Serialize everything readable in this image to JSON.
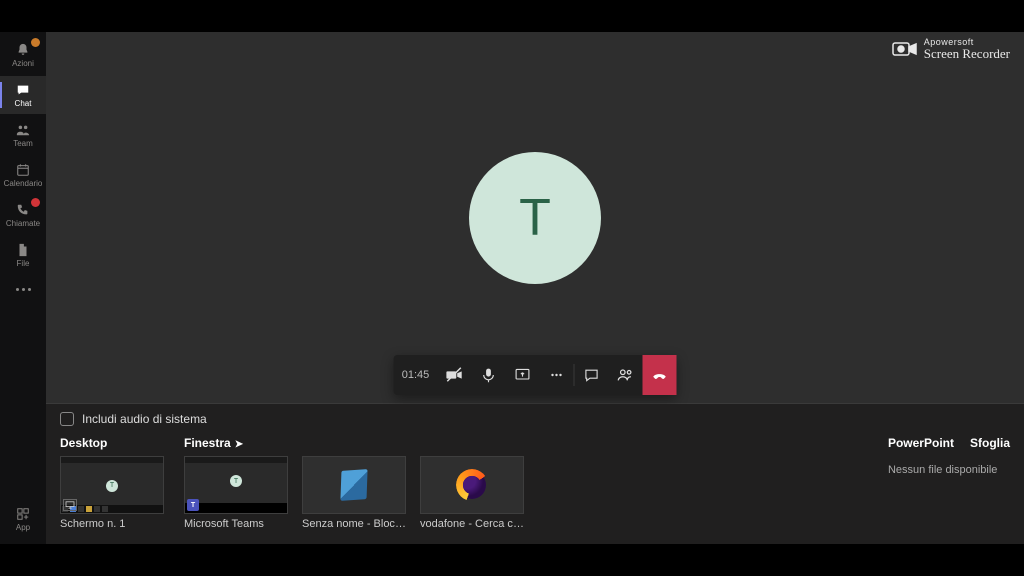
{
  "sidebar": {
    "items": [
      {
        "label": "Azioni",
        "name": "nav-azioni",
        "icon": "bell",
        "badge": "orange"
      },
      {
        "label": "Chat",
        "name": "nav-chat",
        "icon": "chat",
        "active": true
      },
      {
        "label": "Team",
        "name": "nav-team",
        "icon": "team"
      },
      {
        "label": "Calendario",
        "name": "nav-calendario",
        "icon": "calendar"
      },
      {
        "label": "Chiamate",
        "name": "nav-chiamate",
        "icon": "call",
        "badge": "red"
      },
      {
        "label": "File",
        "name": "nav-file",
        "icon": "file"
      }
    ],
    "bottom": {
      "label": "App",
      "name": "nav-app"
    }
  },
  "call": {
    "avatar_initial": "T",
    "timer": "01:45"
  },
  "brand": {
    "top": "Apowersoft",
    "bottom": "Screen Recorder"
  },
  "share": {
    "include_audio": "Includi audio di sistema",
    "desktop_label": "Desktop",
    "finestra_label": "Finestra",
    "powerpoint_label": "PowerPoint",
    "browse_label": "Sfoglia",
    "nofile": "Nessun file disponibile",
    "thumbs": {
      "schermo": "Schermo n. 1",
      "teams": "Microsoft Teams",
      "notepad": "Senza nome - Blocco not…",
      "firefox": "vodafone - Cerca con Go…"
    }
  }
}
